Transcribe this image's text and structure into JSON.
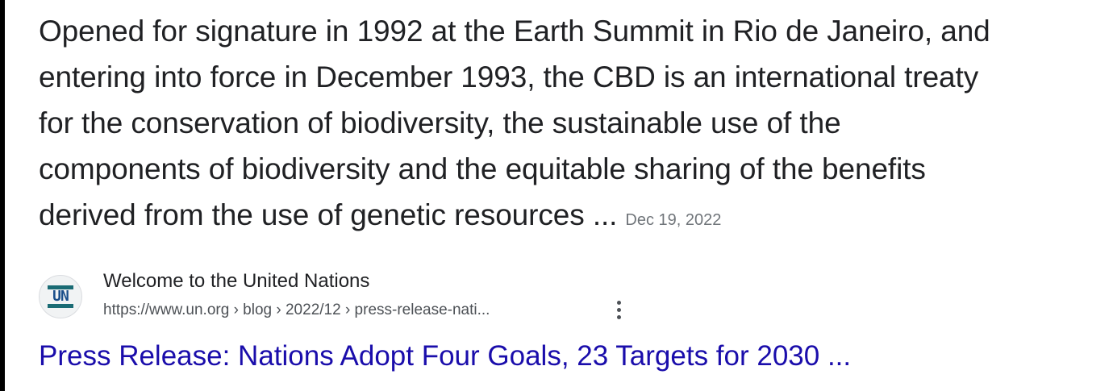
{
  "snippet": {
    "lines": [
      "Opened for signature in 1992 at the Earth Summit in Rio de Janeiro, and",
      "entering into force in December 1993, the CBD is an international treaty",
      "for the conservation of biodiversity, the sustainable use of the",
      "components of biodiversity and the equitable sharing of the benefits",
      "derived from the use of genetic resources ..."
    ],
    "date": "Dec 19, 2022"
  },
  "source": {
    "favicon_icon": "un-logo-icon",
    "favicon_text": "UN",
    "site_name": "Welcome to the United Nations",
    "url": "https://www.un.org › blog › 2022/12 › press-release-nati...",
    "more_icon": "more-vert-icon"
  },
  "result": {
    "title": "Press Release: Nations Adopt Four Goals, 23 Targets for 2030 ..."
  },
  "colors": {
    "link": "#1a0dab",
    "text": "#202124",
    "secondary": "#4d5156",
    "date": "#70757a"
  }
}
